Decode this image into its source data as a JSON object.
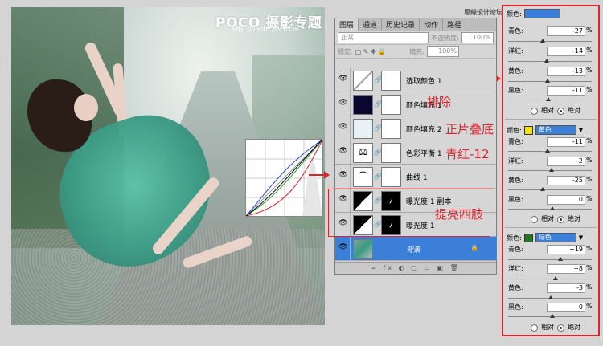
{
  "photo": {
    "brand": "POCO 摄影专题",
    "url": "http://photo.poco.cn/"
  },
  "watermark": "思缘设计论坛 www.MISSYUAN.COM",
  "layers_panel": {
    "tabs": [
      "图层",
      "通道",
      "历史记录",
      "动作",
      "路径"
    ],
    "blend_mode": "正常",
    "opacity_label": "不透明度:",
    "opacity_value": "100%",
    "lock_label": "锁定:",
    "fill_label": "填充:",
    "fill_value": "100%",
    "layers": [
      {
        "name": "选取颜色 1"
      },
      {
        "name": "颜色填充 1"
      },
      {
        "name": "颜色填充 2"
      },
      {
        "name": "色彩平衡 1"
      },
      {
        "name": "曲线 1"
      },
      {
        "name": "曝光度 1 副本"
      },
      {
        "name": "曝光度 1"
      },
      {
        "name": "背景"
      }
    ],
    "bottom_icons": "∞ fx ◐ ▢ ▭ ▣ 🗑"
  },
  "annotations": {
    "exclude": "排除",
    "multiply": "正片叠底",
    "cyan_red": "青红-12",
    "brighten": "提亮四肢"
  },
  "selective_color": {
    "top_label": "颜色:",
    "sections": [
      {
        "color_label": "颜色:",
        "swatch": "#3b7fd8",
        "color_name": "",
        "rows": [
          {
            "label": "青色:",
            "value": "-27",
            "unit": "%"
          },
          {
            "label": "洋红:",
            "value": "-14",
            "unit": "%"
          },
          {
            "label": "黄色:",
            "value": "-13",
            "unit": "%"
          },
          {
            "label": "黑色:",
            "value": "-11",
            "unit": "%"
          }
        ],
        "relative": "相对",
        "absolute": "绝对"
      },
      {
        "color_label": "颜色:",
        "swatch": "#f5e600",
        "color_name": "黄色",
        "rows": [
          {
            "label": "青色:",
            "value": "-11",
            "unit": "%"
          },
          {
            "label": "洋红:",
            "value": "-2",
            "unit": "%"
          },
          {
            "label": "黄色:",
            "value": "-25",
            "unit": "%"
          },
          {
            "label": "黑色:",
            "value": "0",
            "unit": "%"
          }
        ],
        "relative": "相对",
        "absolute": "绝对"
      },
      {
        "color_label": "颜色:",
        "swatch": "#1c7a1c",
        "color_name": "绿色",
        "rows": [
          {
            "label": "青色:",
            "value": "+19",
            "unit": "%"
          },
          {
            "label": "洋红:",
            "value": "+8",
            "unit": "%"
          },
          {
            "label": "黄色:",
            "value": "-3",
            "unit": "%"
          },
          {
            "label": "黑色:",
            "value": "0",
            "unit": "%"
          }
        ],
        "relative": "相对",
        "absolute": "绝对"
      }
    ]
  },
  "colors": {
    "accent_red": "#e0232b",
    "selection_blue": "#3b7fd8"
  }
}
